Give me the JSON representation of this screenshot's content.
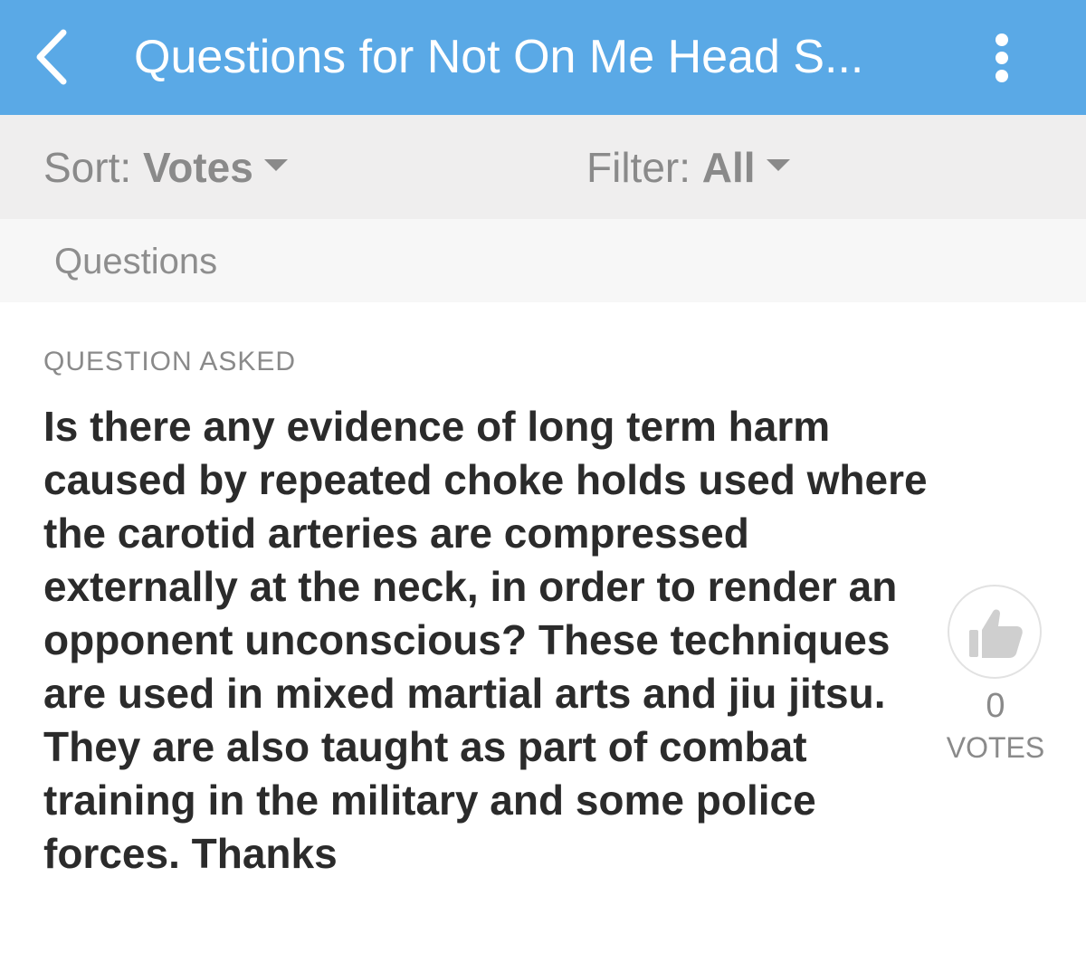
{
  "header": {
    "title": "Questions for Not On Me Head S...",
    "back_icon": "chevron-left-icon",
    "menu_icon": "more-vertical-icon",
    "color": "#5aa9e6"
  },
  "toolbar": {
    "sort_prefix": "Sort:",
    "sort_value": "Votes",
    "filter_prefix": "Filter:",
    "filter_value": "All"
  },
  "section": {
    "label": "Questions"
  },
  "question": {
    "kicker": "QUESTION ASKED",
    "text": "Is there any evidence of long term harm caused by repeated choke holds used where the carotid arteries are compressed externally at the neck, in order to render an opponent unconscious? These techniques are used in mixed martial arts and jiu jitsu. They are also taught as part of combat training in the military and some police forces. Thanks",
    "votes": "0",
    "votes_label": "VOTES",
    "vote_icon": "thumbs-up-icon"
  }
}
